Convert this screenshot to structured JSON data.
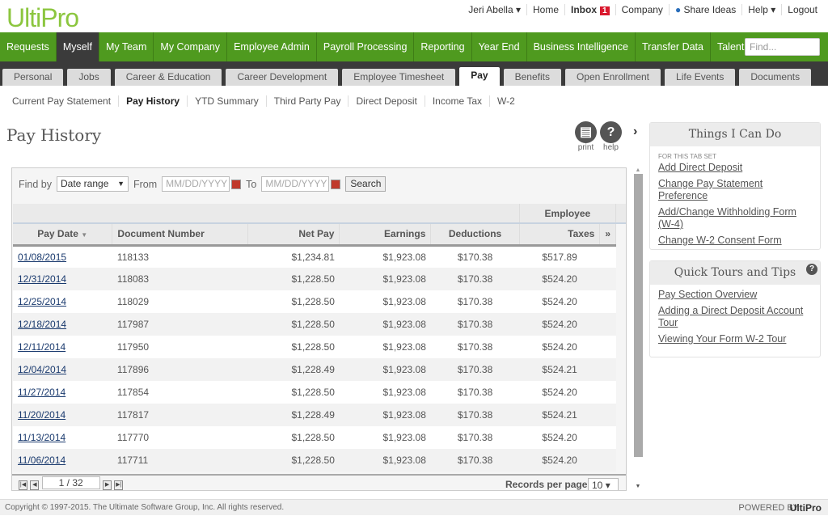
{
  "brand": {
    "logo": "UltiPro",
    "powered_by": "POWERED BY",
    "powered_logo": "UltiPro"
  },
  "toplinks": {
    "user": "Jeri Abella ▾",
    "home": "Home",
    "inbox": "Inbox",
    "inbox_count": "1",
    "company": "Company",
    "share": "Share Ideas",
    "help": "Help ▾",
    "logout": "Logout"
  },
  "mainnav": [
    "Requests",
    "Myself",
    "My Team",
    "My Company",
    "Employee Admin",
    "Payroll Processing",
    "Reporting",
    "Year End",
    "Business Intelligence",
    "Transfer Data",
    "Talent Manager"
  ],
  "find_placeholder": "Find...",
  "tabs": [
    "Personal",
    "Jobs",
    "Career & Education",
    "Career Development",
    "Employee Timesheet",
    "Pay",
    "Benefits",
    "Open Enrollment",
    "Life Events",
    "Documents"
  ],
  "subnav": [
    "Current Pay Statement",
    "Pay History",
    "YTD Summary",
    "Third Party Pay",
    "Direct Deposit",
    "Income Tax",
    "W-2"
  ],
  "page_title": "Pay History",
  "actions": {
    "print": "print",
    "help": "help"
  },
  "filter": {
    "find_by": "Find by",
    "mode": "Date range",
    "from": "From",
    "to": "To",
    "placeholder": "MM/DD/YYYY",
    "search": "Search"
  },
  "table": {
    "group": "Employee",
    "columns": [
      "Pay Date",
      "Document Number",
      "Net Pay",
      "Earnings",
      "Deductions",
      "Taxes"
    ],
    "rows": [
      [
        "01/08/2015",
        "118133",
        "$1,234.81",
        "$1,923.08",
        "$170.38",
        "$517.89"
      ],
      [
        "12/31/2014",
        "118083",
        "$1,228.50",
        "$1,923.08",
        "$170.38",
        "$524.20"
      ],
      [
        "12/25/2014",
        "118029",
        "$1,228.50",
        "$1,923.08",
        "$170.38",
        "$524.20"
      ],
      [
        "12/18/2014",
        "117987",
        "$1,228.50",
        "$1,923.08",
        "$170.38",
        "$524.20"
      ],
      [
        "12/11/2014",
        "117950",
        "$1,228.50",
        "$1,923.08",
        "$170.38",
        "$524.20"
      ],
      [
        "12/04/2014",
        "117896",
        "$1,228.49",
        "$1,923.08",
        "$170.38",
        "$524.21"
      ],
      [
        "11/27/2014",
        "117854",
        "$1,228.50",
        "$1,923.08",
        "$170.38",
        "$524.20"
      ],
      [
        "11/20/2014",
        "117817",
        "$1,228.49",
        "$1,923.08",
        "$170.38",
        "$524.21"
      ],
      [
        "11/13/2014",
        "117770",
        "$1,228.50",
        "$1,923.08",
        "$170.38",
        "$524.20"
      ],
      [
        "11/06/2014",
        "117711",
        "$1,228.50",
        "$1,923.08",
        "$170.38",
        "$524.20"
      ]
    ]
  },
  "pager": {
    "page": "1 / 32",
    "records_label": "Records per page",
    "per_page": "10"
  },
  "things": {
    "title": "Things I Can Do",
    "subtitle": "FOR THIS TAB SET",
    "links": [
      "Add Direct Deposit",
      "Change Pay Statement Preference",
      "Add/Change Withholding Form (W-4)",
      "Change W-2 Consent Form"
    ]
  },
  "tours": {
    "title": "Quick Tours and Tips",
    "links": [
      "Pay Section Overview",
      "Adding a Direct Deposit Account Tour",
      "Viewing Your Form W-2 Tour"
    ]
  },
  "footer": "Copyright © 1997-2015. The Ultimate Software Group, Inc. All rights reserved.",
  "colors": {
    "nav_green": "#4f9a1f",
    "logo_green": "#8cc63f",
    "inbox_badge": "#d9182d"
  }
}
